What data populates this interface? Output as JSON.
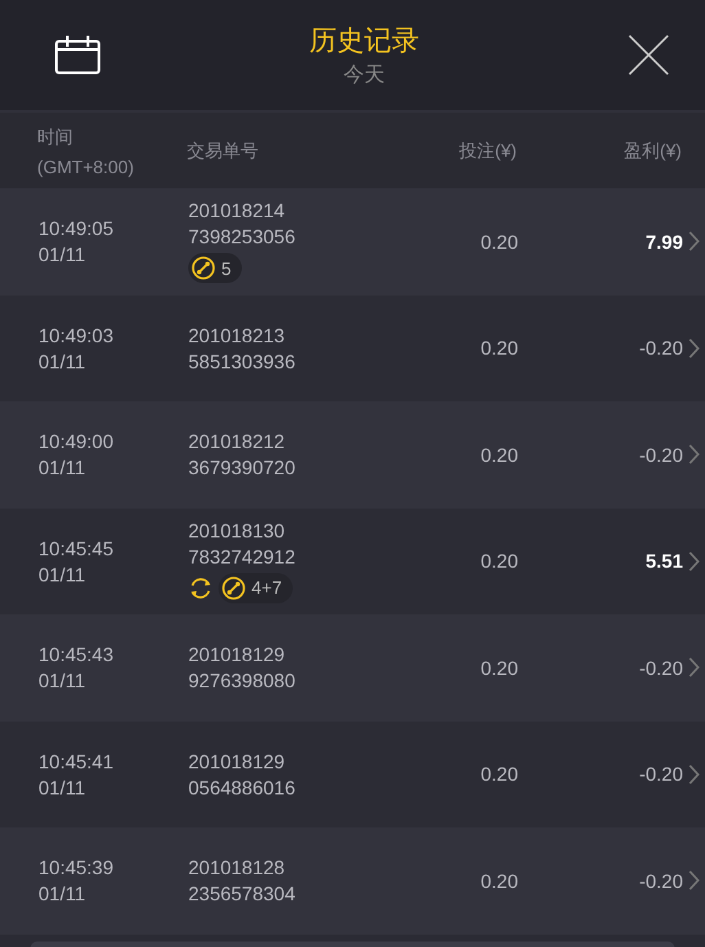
{
  "header": {
    "title": "历史记录",
    "subtitle": "今天"
  },
  "columns": {
    "time": "时间",
    "timezone": "(GMT+8:00)",
    "order": "交易单号",
    "stake": "投注(¥)",
    "profit": "盈利(¥)"
  },
  "rows": [
    {
      "time": "10:49:05",
      "date": "01/11",
      "order_1": "201018214",
      "order_2": "7398253056",
      "stake": "0.20",
      "profit": "7.99",
      "win": true,
      "cycle": false,
      "bonus": "5"
    },
    {
      "time": "10:49:03",
      "date": "01/11",
      "order_1": "201018213",
      "order_2": "5851303936",
      "stake": "0.20",
      "profit": "-0.20",
      "win": false,
      "cycle": false
    },
    {
      "time": "10:49:00",
      "date": "01/11",
      "order_1": "201018212",
      "order_2": "3679390720",
      "stake": "0.20",
      "profit": "-0.20",
      "win": false,
      "cycle": false
    },
    {
      "time": "10:45:45",
      "date": "01/11",
      "order_1": "201018130",
      "order_2": "7832742912",
      "stake": "0.20",
      "profit": "5.51",
      "win": true,
      "cycle": true,
      "bonus": "4+7"
    },
    {
      "time": "10:45:43",
      "date": "01/11",
      "order_1": "201018129",
      "order_2": "9276398080",
      "stake": "0.20",
      "profit": "-0.20",
      "win": false,
      "cycle": false
    },
    {
      "time": "10:45:41",
      "date": "01/11",
      "order_1": "201018129",
      "order_2": "0564886016",
      "stake": "0.20",
      "profit": "-0.20",
      "win": false,
      "cycle": false
    },
    {
      "time": "10:45:39",
      "date": "01/11",
      "order_1": "201018128",
      "order_2": "2356578304",
      "stake": "0.20",
      "profit": "-0.20",
      "win": false,
      "cycle": false
    }
  ]
}
